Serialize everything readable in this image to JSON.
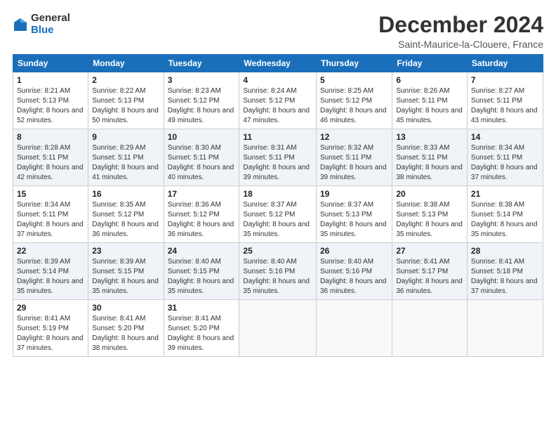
{
  "logo": {
    "general": "General",
    "blue": "Blue"
  },
  "title": "December 2024",
  "subtitle": "Saint-Maurice-la-Clouere, France",
  "days_header": [
    "Sunday",
    "Monday",
    "Tuesday",
    "Wednesday",
    "Thursday",
    "Friday",
    "Saturday"
  ],
  "weeks": [
    [
      {
        "num": "1",
        "sunrise": "Sunrise: 8:21 AM",
        "sunset": "Sunset: 5:13 PM",
        "daylight": "Daylight: 8 hours and 52 minutes."
      },
      {
        "num": "2",
        "sunrise": "Sunrise: 8:22 AM",
        "sunset": "Sunset: 5:13 PM",
        "daylight": "Daylight: 8 hours and 50 minutes."
      },
      {
        "num": "3",
        "sunrise": "Sunrise: 8:23 AM",
        "sunset": "Sunset: 5:12 PM",
        "daylight": "Daylight: 8 hours and 49 minutes."
      },
      {
        "num": "4",
        "sunrise": "Sunrise: 8:24 AM",
        "sunset": "Sunset: 5:12 PM",
        "daylight": "Daylight: 8 hours and 47 minutes."
      },
      {
        "num": "5",
        "sunrise": "Sunrise: 8:25 AM",
        "sunset": "Sunset: 5:12 PM",
        "daylight": "Daylight: 8 hours and 46 minutes."
      },
      {
        "num": "6",
        "sunrise": "Sunrise: 8:26 AM",
        "sunset": "Sunset: 5:11 PM",
        "daylight": "Daylight: 8 hours and 45 minutes."
      },
      {
        "num": "7",
        "sunrise": "Sunrise: 8:27 AM",
        "sunset": "Sunset: 5:11 PM",
        "daylight": "Daylight: 8 hours and 43 minutes."
      }
    ],
    [
      {
        "num": "8",
        "sunrise": "Sunrise: 8:28 AM",
        "sunset": "Sunset: 5:11 PM",
        "daylight": "Daylight: 8 hours and 42 minutes."
      },
      {
        "num": "9",
        "sunrise": "Sunrise: 8:29 AM",
        "sunset": "Sunset: 5:11 PM",
        "daylight": "Daylight: 8 hours and 41 minutes."
      },
      {
        "num": "10",
        "sunrise": "Sunrise: 8:30 AM",
        "sunset": "Sunset: 5:11 PM",
        "daylight": "Daylight: 8 hours and 40 minutes."
      },
      {
        "num": "11",
        "sunrise": "Sunrise: 8:31 AM",
        "sunset": "Sunset: 5:11 PM",
        "daylight": "Daylight: 8 hours and 39 minutes."
      },
      {
        "num": "12",
        "sunrise": "Sunrise: 8:32 AM",
        "sunset": "Sunset: 5:11 PM",
        "daylight": "Daylight: 8 hours and 39 minutes."
      },
      {
        "num": "13",
        "sunrise": "Sunrise: 8:33 AM",
        "sunset": "Sunset: 5:11 PM",
        "daylight": "Daylight: 8 hours and 38 minutes."
      },
      {
        "num": "14",
        "sunrise": "Sunrise: 8:34 AM",
        "sunset": "Sunset: 5:11 PM",
        "daylight": "Daylight: 8 hours and 37 minutes."
      }
    ],
    [
      {
        "num": "15",
        "sunrise": "Sunrise: 8:34 AM",
        "sunset": "Sunset: 5:11 PM",
        "daylight": "Daylight: 8 hours and 37 minutes."
      },
      {
        "num": "16",
        "sunrise": "Sunrise: 8:35 AM",
        "sunset": "Sunset: 5:12 PM",
        "daylight": "Daylight: 8 hours and 36 minutes."
      },
      {
        "num": "17",
        "sunrise": "Sunrise: 8:36 AM",
        "sunset": "Sunset: 5:12 PM",
        "daylight": "Daylight: 8 hours and 36 minutes."
      },
      {
        "num": "18",
        "sunrise": "Sunrise: 8:37 AM",
        "sunset": "Sunset: 5:12 PM",
        "daylight": "Daylight: 8 hours and 35 minutes."
      },
      {
        "num": "19",
        "sunrise": "Sunrise: 8:37 AM",
        "sunset": "Sunset: 5:13 PM",
        "daylight": "Daylight: 8 hours and 35 minutes."
      },
      {
        "num": "20",
        "sunrise": "Sunrise: 8:38 AM",
        "sunset": "Sunset: 5:13 PM",
        "daylight": "Daylight: 8 hours and 35 minutes."
      },
      {
        "num": "21",
        "sunrise": "Sunrise: 8:38 AM",
        "sunset": "Sunset: 5:14 PM",
        "daylight": "Daylight: 8 hours and 35 minutes."
      }
    ],
    [
      {
        "num": "22",
        "sunrise": "Sunrise: 8:39 AM",
        "sunset": "Sunset: 5:14 PM",
        "daylight": "Daylight: 8 hours and 35 minutes."
      },
      {
        "num": "23",
        "sunrise": "Sunrise: 8:39 AM",
        "sunset": "Sunset: 5:15 PM",
        "daylight": "Daylight: 8 hours and 35 minutes."
      },
      {
        "num": "24",
        "sunrise": "Sunrise: 8:40 AM",
        "sunset": "Sunset: 5:15 PM",
        "daylight": "Daylight: 8 hours and 35 minutes."
      },
      {
        "num": "25",
        "sunrise": "Sunrise: 8:40 AM",
        "sunset": "Sunset: 5:16 PM",
        "daylight": "Daylight: 8 hours and 35 minutes."
      },
      {
        "num": "26",
        "sunrise": "Sunrise: 8:40 AM",
        "sunset": "Sunset: 5:16 PM",
        "daylight": "Daylight: 8 hours and 36 minutes."
      },
      {
        "num": "27",
        "sunrise": "Sunrise: 8:41 AM",
        "sunset": "Sunset: 5:17 PM",
        "daylight": "Daylight: 8 hours and 36 minutes."
      },
      {
        "num": "28",
        "sunrise": "Sunrise: 8:41 AM",
        "sunset": "Sunset: 5:18 PM",
        "daylight": "Daylight: 8 hours and 37 minutes."
      }
    ],
    [
      {
        "num": "29",
        "sunrise": "Sunrise: 8:41 AM",
        "sunset": "Sunset: 5:19 PM",
        "daylight": "Daylight: 8 hours and 37 minutes."
      },
      {
        "num": "30",
        "sunrise": "Sunrise: 8:41 AM",
        "sunset": "Sunset: 5:20 PM",
        "daylight": "Daylight: 8 hours and 38 minutes."
      },
      {
        "num": "31",
        "sunrise": "Sunrise: 8:41 AM",
        "sunset": "Sunset: 5:20 PM",
        "daylight": "Daylight: 8 hours and 39 minutes."
      },
      null,
      null,
      null,
      null
    ]
  ]
}
